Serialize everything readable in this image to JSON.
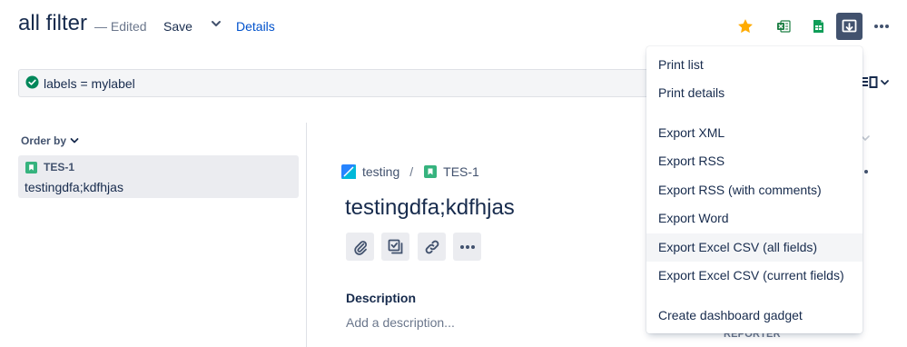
{
  "header": {
    "title": "all filter",
    "edited": "— Edited",
    "save_label": "Save",
    "details_label": "Details"
  },
  "toolbar_icons": [
    "star-icon",
    "excel-icon",
    "google-sheets-icon",
    "export-icon",
    "more-icon"
  ],
  "jql": {
    "query": "labels = mylabel"
  },
  "left_panel": {
    "order_by": "Order by",
    "issues": [
      {
        "key": "TES-1",
        "summary": "testingdfa;kdfhjas"
      }
    ]
  },
  "issue": {
    "project": "testing",
    "separator": "/",
    "key": "TES-1",
    "title": "testingdfa;kdfhjas",
    "description_label": "Description",
    "description_placeholder": "Add a description...",
    "reporter_label": "REPORTER"
  },
  "export_menu": {
    "items": [
      "Print list",
      "Print details",
      "Export XML",
      "Export RSS",
      "Export RSS (with comments)",
      "Export Word",
      "Export Excel CSV (all fields)",
      "Export Excel CSV (current fields)",
      "Create dashboard gadget"
    ],
    "hovered_item": "Export Excel CSV (all fields)"
  },
  "colors": {
    "primary_text": "#172B4D",
    "link": "#0052CC",
    "star": "#FFAB00",
    "success": "#00875A",
    "story": "#36B37E",
    "excel": "#1D7F44",
    "export_button": "#42526E"
  }
}
